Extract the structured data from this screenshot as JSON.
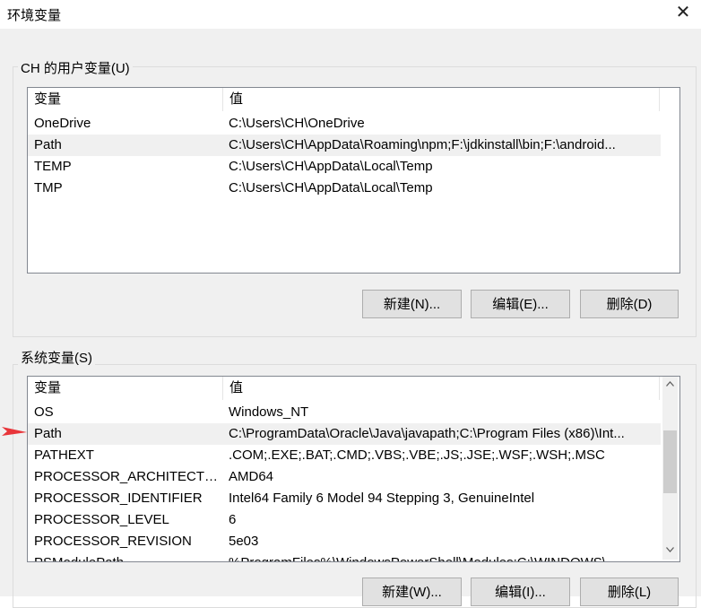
{
  "window": {
    "title": "环境变量",
    "close_glyph": "✕"
  },
  "user_vars": {
    "group_label": "CH 的用户变量(U)",
    "headers": {
      "name": "变量",
      "value": "值"
    },
    "rows": [
      {
        "name": "OneDrive",
        "value": "C:\\Users\\CH\\OneDrive",
        "selected": false
      },
      {
        "name": "Path",
        "value": "C:\\Users\\CH\\AppData\\Roaming\\npm;F:\\jdkinstall\\bin;F:\\android...",
        "selected": true
      },
      {
        "name": "TEMP",
        "value": "C:\\Users\\CH\\AppData\\Local\\Temp",
        "selected": false
      },
      {
        "name": "TMP",
        "value": "C:\\Users\\CH\\AppData\\Local\\Temp",
        "selected": false
      }
    ],
    "buttons": {
      "new": "新建(N)...",
      "edit": "编辑(E)...",
      "delete": "删除(D)"
    }
  },
  "system_vars": {
    "group_label": "系统变量(S)",
    "headers": {
      "name": "变量",
      "value": "值"
    },
    "rows": [
      {
        "name": "OS",
        "value": "Windows_NT",
        "selected": false
      },
      {
        "name": "Path",
        "value": "C:\\ProgramData\\Oracle\\Java\\javapath;C:\\Program Files (x86)\\Int...",
        "selected": true
      },
      {
        "name": "PATHEXT",
        "value": ".COM;.EXE;.BAT;.CMD;.VBS;.VBE;.JS;.JSE;.WSF;.WSH;.MSC",
        "selected": false
      },
      {
        "name": "PROCESSOR_ARCHITECTURE",
        "value": "AMD64",
        "selected": false
      },
      {
        "name": "PROCESSOR_IDENTIFIER",
        "value": "Intel64 Family 6 Model 94 Stepping 3, GenuineIntel",
        "selected": false
      },
      {
        "name": "PROCESSOR_LEVEL",
        "value": "6",
        "selected": false
      },
      {
        "name": "PROCESSOR_REVISION",
        "value": "5e03",
        "selected": false
      },
      {
        "name": "PSModulePath",
        "value": "%ProgramFiles%\\WindowsPowerShell\\Modules;C:\\WINDOWS\\...",
        "selected": false
      }
    ],
    "buttons": {
      "new": "新建(W)...",
      "edit": "编辑(I)...",
      "delete": "删除(L)"
    }
  },
  "colors": {
    "annotation_arrow": "#e8353a",
    "selected_row": "#f0f0f0",
    "dialog_bg": "#f0f0f0"
  },
  "icons": {
    "annotation": "red-arrow-icon",
    "scroll_up": "chevron-up-icon",
    "scroll_down": "chevron-down-icon"
  }
}
